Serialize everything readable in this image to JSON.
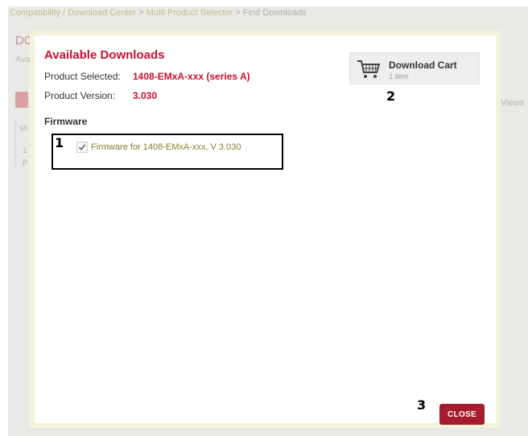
{
  "background": {
    "breadcrumb": [
      "Compatibility",
      "Download Center",
      "Multi Product Selector",
      "Find Downloads"
    ],
    "breadcrumb_separators": [
      "/",
      ">",
      ">"
    ],
    "page_title_fragment": "DO",
    "subtitle_fragment": "Ava",
    "sidebar_fragment_1": "sh",
    "sidebar_fragment_2": "1",
    "sidebar_fragment_3": "p",
    "views_fragment": "Views"
  },
  "modal": {
    "title": "Available Downloads",
    "product_label": "Product Selected:",
    "product_value": "1408-EMxA-xxx (series A)",
    "version_label": "Product Version:",
    "version_value": "3.030",
    "section_heading": "Firmware",
    "firmware_items": [
      {
        "label": "Firmware for 1408-EMxA-xxx, V 3.030",
        "checked": true
      }
    ],
    "cart": {
      "title": "Download Cart",
      "count": "1 item",
      "icon": "shopping-cart-icon"
    },
    "close_label": "CLOSE"
  },
  "callouts": [
    "1",
    "2",
    "3"
  ],
  "colors": {
    "accent_red": "#c8102e",
    "close_button": "#a61c2e",
    "item_text": "#8c7b2e",
    "modal_border": "#f4f1dd"
  }
}
